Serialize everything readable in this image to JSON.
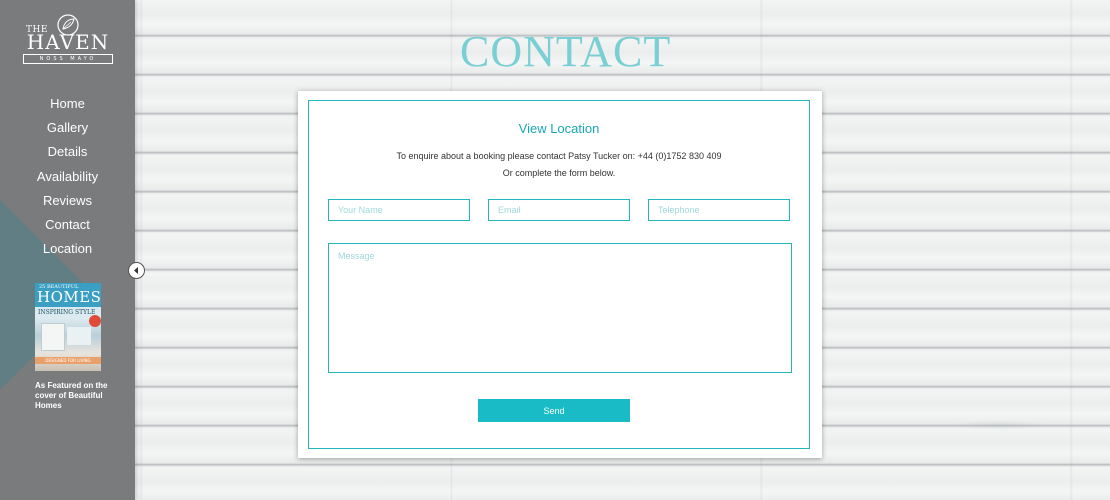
{
  "brand": {
    "the": "THE",
    "name": "HAVEN",
    "sub": "NOSS MAYO"
  },
  "nav": {
    "items": [
      {
        "label": "Home"
      },
      {
        "label": "Gallery"
      },
      {
        "label": "Details"
      },
      {
        "label": "Availability"
      },
      {
        "label": "Reviews"
      },
      {
        "label": "Contact"
      },
      {
        "label": "Location"
      }
    ]
  },
  "magazine": {
    "brand_top": "25 BEAUTIFUL",
    "brand": "HOMES",
    "headline": "INSPIRING STYLE",
    "footer": "DESIGNED FOR LIVING",
    "caption": "As Featured on the cover of Beautiful Homes"
  },
  "page": {
    "title": "CONTACT"
  },
  "contact": {
    "view_location": "View Location",
    "enquiry_line1": "To enquire about a booking please contact Patsy Tucker on: +44 (0)1752 830 409",
    "enquiry_line2": "Or complete the form below.",
    "form": {
      "name_placeholder": "Your Name",
      "email_placeholder": "Email",
      "telephone_placeholder": "Telephone",
      "message_placeholder": "Message",
      "send_label": "Send"
    }
  },
  "colors": {
    "accent": "#19bcc6",
    "title": "#79cfd4",
    "sidebar": "#7a7b7c"
  },
  "icons": {
    "logo": "leaf-icon",
    "collapse": "chevron-left-icon"
  }
}
